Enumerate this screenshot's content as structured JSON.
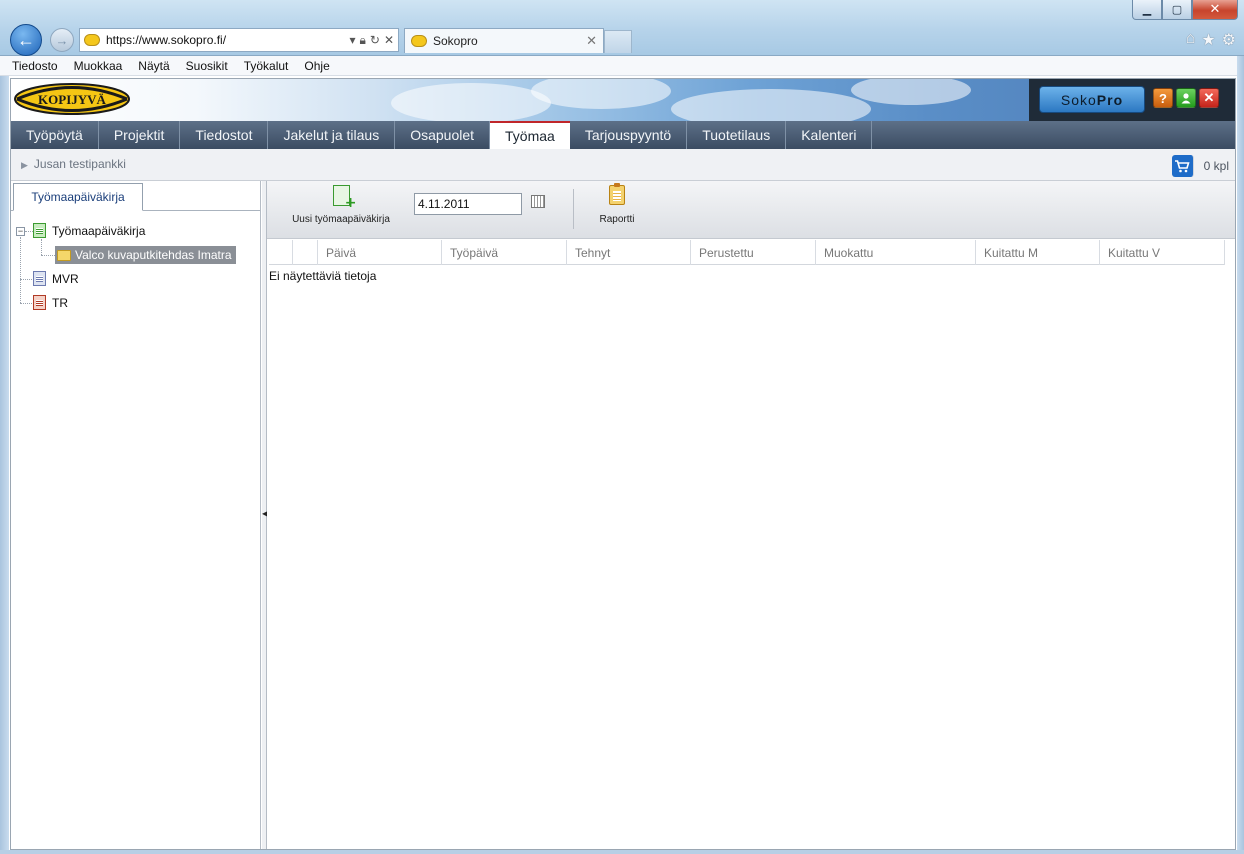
{
  "browser": {
    "url": "https://www.sokopro.fi/",
    "tab_title": "Sokopro",
    "window_controls": [
      "minimize",
      "maximize",
      "close"
    ]
  },
  "menubar": {
    "items": [
      "Tiedosto",
      "Muokkaa",
      "Näytä",
      "Suosikit",
      "Työkalut",
      "Ohje"
    ]
  },
  "header": {
    "logo_text": "KOPIJYVÄ",
    "soko_prefix": "Soko",
    "soko_suffix": "Pro",
    "help_label": "?",
    "exit_label": "✕"
  },
  "nav": {
    "tabs": [
      {
        "label": "Työpöytä"
      },
      {
        "label": "Projektit"
      },
      {
        "label": "Tiedostot"
      },
      {
        "label": "Jakelut ja tilaus"
      },
      {
        "label": "Osapuolet"
      },
      {
        "label": "Työmaa",
        "active": true
      },
      {
        "label": "Tarjouspyyntö"
      },
      {
        "label": "Tuotetilaus"
      },
      {
        "label": "Kalenteri"
      }
    ]
  },
  "breadcrumb": {
    "label": "Jusan testipankki"
  },
  "cart": {
    "count_label": "0 kpl"
  },
  "left_panel": {
    "tab_label": "Työmaapäiväkirja",
    "tree": {
      "root": "Työmaapäiväkirja",
      "child": "Valco kuvaputkitehdas Imatra",
      "mvr": "MVR",
      "tr": "TR"
    }
  },
  "toolbar": {
    "new_label": "Uusi työmaapäiväkirja",
    "date_value": "4.11.2011",
    "report_label": "Raportti"
  },
  "grid": {
    "columns": [
      "",
      "",
      "Päivä",
      "Työpäivä",
      "Tehnyt",
      "Perustettu",
      "Muokattu",
      "Kuitattu M",
      "Kuitattu V"
    ],
    "empty_message": "Ei näytettäviä tietoja"
  },
  "colors": {
    "active_tab_accent": "#c0262a",
    "nav_bg": "#3b4c62",
    "cart_blue": "#1e6cc8"
  }
}
